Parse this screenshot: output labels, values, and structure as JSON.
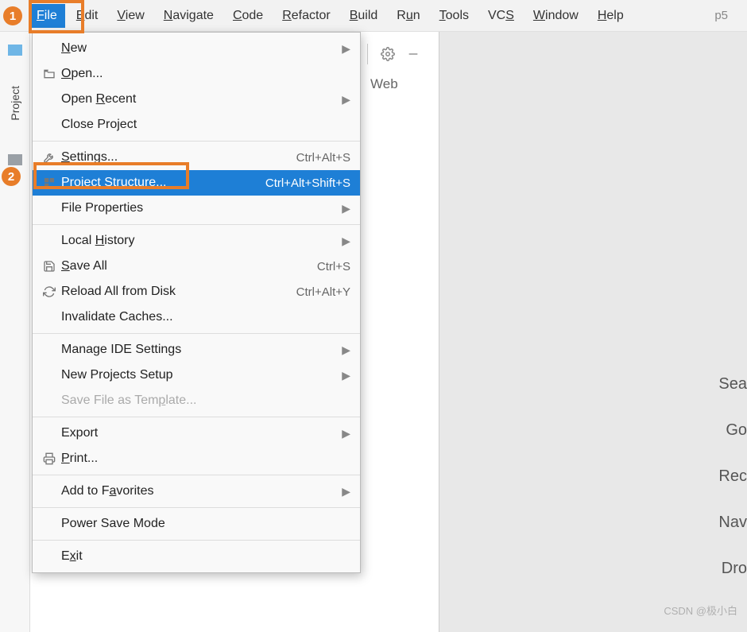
{
  "project_name": "p5",
  "menubar": {
    "items": [
      {
        "text": "File",
        "mn": 0,
        "active": true
      },
      {
        "text": "Edit",
        "mn": 0
      },
      {
        "text": "View",
        "mn": 0
      },
      {
        "text": "Navigate",
        "mn": 0
      },
      {
        "text": "Code",
        "mn": 0
      },
      {
        "text": "Refactor",
        "mn": 0
      },
      {
        "text": "Build",
        "mn": 0
      },
      {
        "text": "Run",
        "mn": 1
      },
      {
        "text": "Tools",
        "mn": 0
      },
      {
        "text": "VCS",
        "mn": 2
      },
      {
        "text": "Window",
        "mn": 0
      },
      {
        "text": "Help",
        "mn": 0
      }
    ]
  },
  "sidebar": {
    "project_tab": "Project"
  },
  "tab_behind": "Web",
  "dropdown": {
    "items": [
      {
        "label": "New",
        "mn": 0,
        "submenu": true
      },
      {
        "label": "Open...",
        "mn": 0,
        "icon": "folder-open"
      },
      {
        "label": "Open Recent",
        "mn": 5,
        "submenu": true
      },
      {
        "label": "Close Project"
      },
      {
        "sep": true
      },
      {
        "label": "Settings...",
        "mn": 0,
        "shortcut": "Ctrl+Alt+S",
        "icon": "wrench"
      },
      {
        "label": "Project Structure...",
        "mn": 8,
        "shortcut": "Ctrl+Alt+Shift+S",
        "icon": "struct",
        "selected": true
      },
      {
        "label": "File Properties",
        "submenu": true
      },
      {
        "sep": true
      },
      {
        "label": "Local History",
        "mn": 6,
        "submenu": true
      },
      {
        "label": "Save All",
        "mn": 0,
        "shortcut": "Ctrl+S",
        "icon": "save"
      },
      {
        "label": "Reload All from Disk",
        "shortcut": "Ctrl+Alt+Y",
        "icon": "reload"
      },
      {
        "label": "Invalidate Caches..."
      },
      {
        "sep": true
      },
      {
        "label": "Manage IDE Settings",
        "submenu": true
      },
      {
        "label": "New Projects Setup",
        "submenu": true
      },
      {
        "label": "Save File as Template...",
        "mn": 16,
        "disabled": true
      },
      {
        "sep": true
      },
      {
        "label": "Export",
        "submenu": true
      },
      {
        "label": "Print...",
        "mn": 0,
        "icon": "print"
      },
      {
        "sep": true
      },
      {
        "label": "Add to Favorites",
        "mn": 8,
        "submenu": true
      },
      {
        "sep": true
      },
      {
        "label": "Power Save Mode"
      },
      {
        "sep": true
      },
      {
        "label": "Exit",
        "mn": 1
      }
    ]
  },
  "right_hints": [
    "Sea",
    "Go",
    "Rec",
    "Nav",
    "Dro"
  ],
  "annotations": {
    "badge1": "1",
    "badge2": "2"
  },
  "watermark": "CSDN @极小白"
}
